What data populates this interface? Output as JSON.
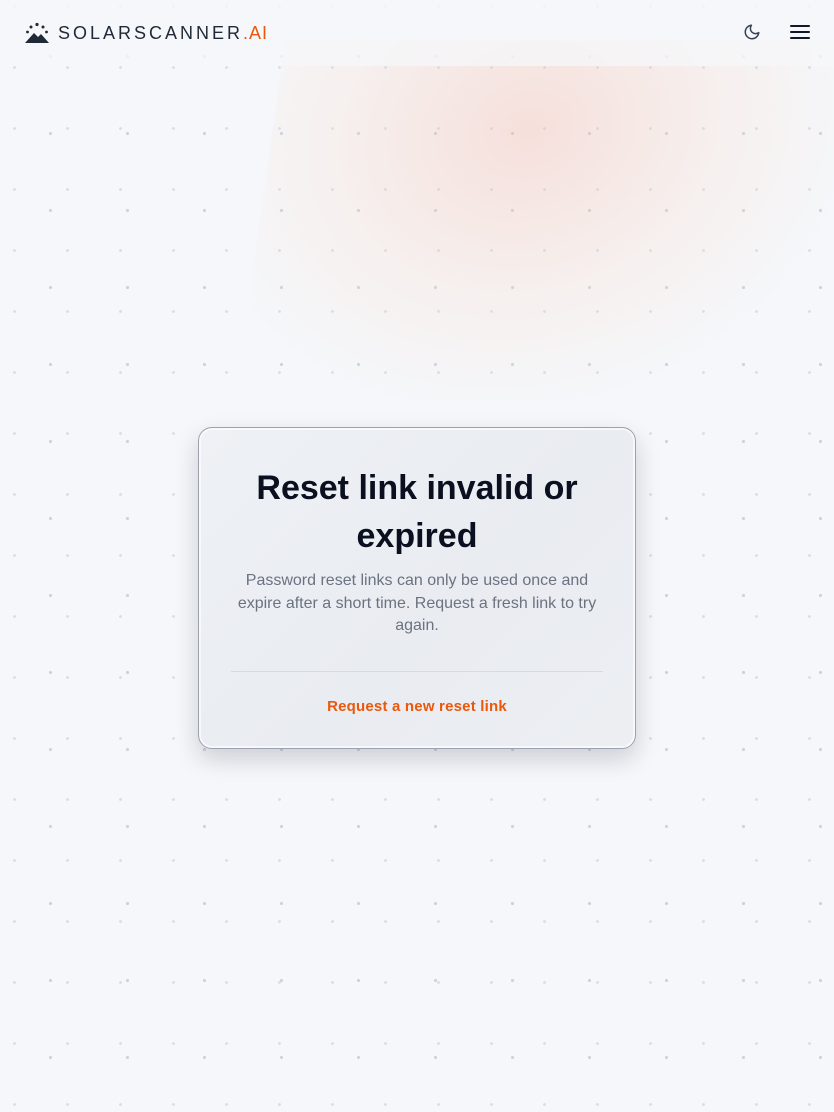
{
  "header": {
    "brand_main": "SOLARSCANNER",
    "brand_accent": ".AI",
    "logo_icon": "sunrise-mountain-icon",
    "theme_toggle_icon": "moon-icon",
    "menu_icon": "hamburger-menu-icon"
  },
  "card": {
    "title": "Reset link invalid or expired",
    "message": "Password reset links can only be used once and expire after a short time. Request a fresh link to try again.",
    "action_label": "Request a new reset link"
  },
  "colors": {
    "accent": "#ea580c",
    "background": "#f5f7fa",
    "title": "#0b1020",
    "muted_text": "#6b7280"
  }
}
